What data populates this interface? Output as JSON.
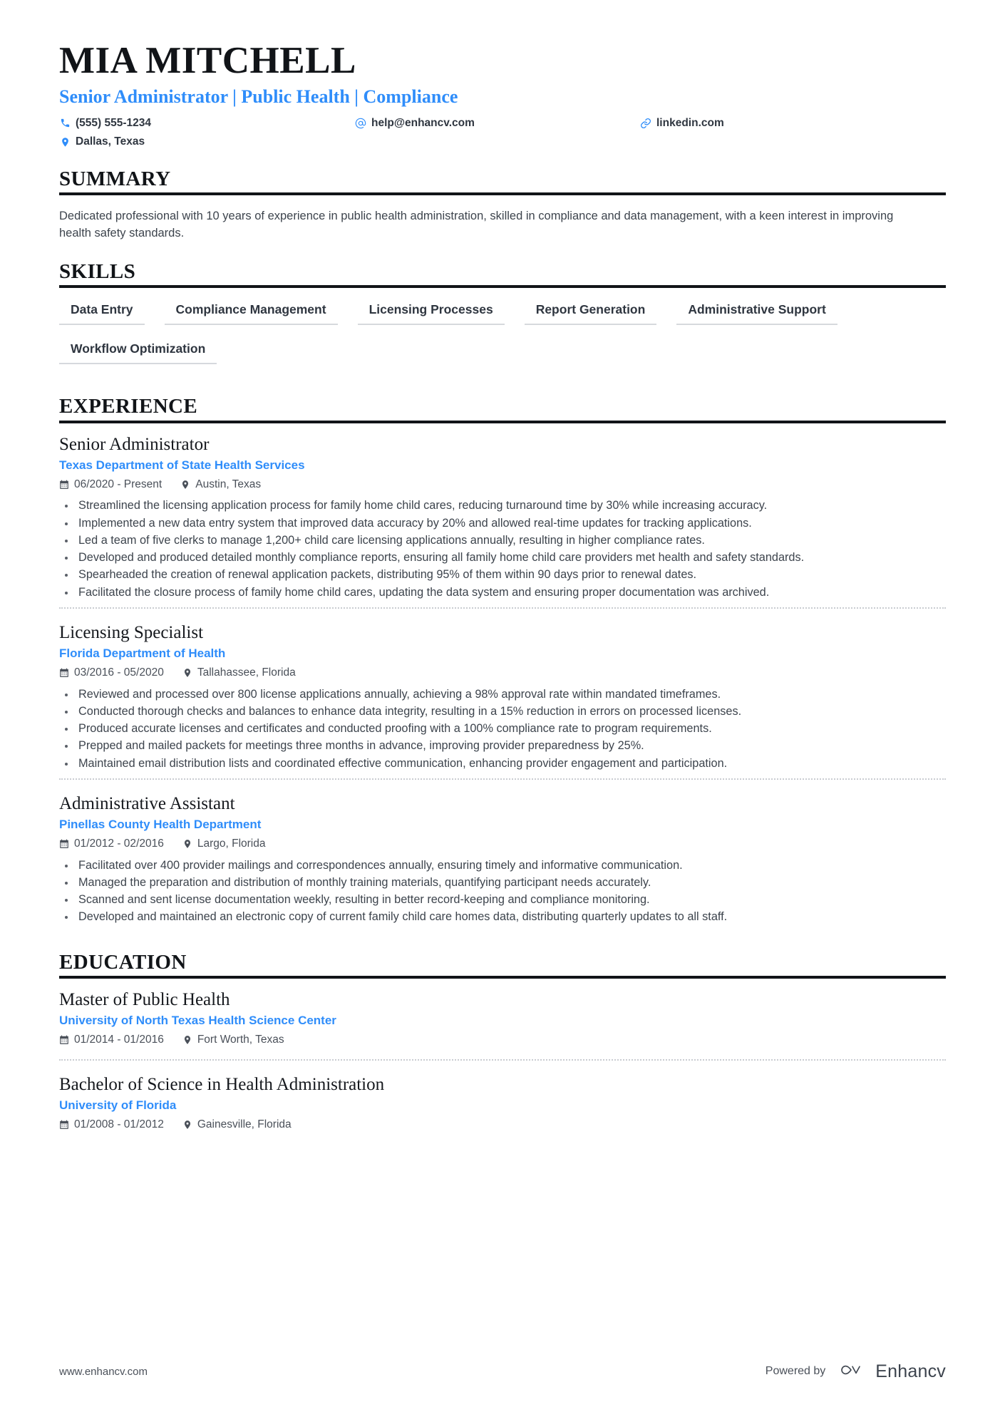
{
  "header": {
    "name": "MIA MITCHELL",
    "title": "Senior Administrator | Public Health | Compliance",
    "contacts": {
      "phone": "(555) 555-1234",
      "email": "help@enhancv.com",
      "link": "linkedin.com",
      "location": "Dallas, Texas"
    },
    "icons": {
      "phone": "phone-icon",
      "email": "at-sign-icon",
      "link": "link-icon",
      "location": "map-pin-icon"
    }
  },
  "colors": {
    "accent_blue": "#2f8dfa",
    "heading_black": "#111418",
    "body_gray": "#3d444d",
    "rule_gray": "#d6d9dd"
  },
  "sections": {
    "summary": {
      "title": "SUMMARY",
      "text": "Dedicated professional with 10 years of experience in public health administration, skilled in compliance and data management, with a keen interest in improving health safety standards."
    },
    "skills": {
      "title": "SKILLS",
      "items": [
        "Data Entry",
        "Compliance Management",
        "Licensing Processes",
        "Report Generation",
        "Administrative Support",
        "Workflow Optimization"
      ]
    },
    "experience": {
      "title": "EXPERIENCE",
      "entries": [
        {
          "role": "Senior Administrator",
          "organization": "Texas Department of State Health Services",
          "dates": "06/2020 - Present",
          "location": "Austin, Texas",
          "bullets": [
            "Streamlined the licensing application process for family home child cares, reducing turnaround time by 30% while increasing accuracy.",
            "Implemented a new data entry system that improved data accuracy by 20% and allowed real-time updates for tracking applications.",
            "Led a team of five clerks to manage 1,200+ child care licensing applications annually, resulting in higher compliance rates.",
            "Developed and produced detailed monthly compliance reports, ensuring all family home child care providers met health and safety standards.",
            "Spearheaded the creation of renewal application packets, distributing 95% of them within 90 days prior to renewal dates.",
            "Facilitated the closure process of family home child cares, updating the data system and ensuring proper documentation was archived."
          ]
        },
        {
          "role": "Licensing Specialist",
          "organization": "Florida Department of Health",
          "dates": "03/2016 - 05/2020",
          "location": "Tallahassee, Florida",
          "bullets": [
            "Reviewed and processed over 800 license applications annually, achieving a 98% approval rate within mandated timeframes.",
            "Conducted thorough checks and balances to enhance data integrity, resulting in a 15% reduction in errors on processed licenses.",
            "Produced accurate licenses and certificates and conducted proofing with a 100% compliance rate to program requirements.",
            "Prepped and mailed packets for meetings three months in advance, improving provider preparedness by 25%.",
            "Maintained email distribution lists and coordinated effective communication, enhancing provider engagement and participation."
          ]
        },
        {
          "role": "Administrative Assistant",
          "organization": "Pinellas County Health Department",
          "dates": "01/2012 - 02/2016",
          "location": "Largo, Florida",
          "bullets": [
            "Facilitated over 400 provider mailings and correspondences annually, ensuring timely and informative communication.",
            "Managed the preparation and distribution of monthly training materials, quantifying participant needs accurately.",
            "Scanned and sent license documentation weekly, resulting in better record-keeping and compliance monitoring.",
            "Developed and maintained an electronic copy of current family child care homes data, distributing quarterly updates to all staff."
          ]
        }
      ]
    },
    "education": {
      "title": "EDUCATION",
      "entries": [
        {
          "role": "Master of Public Health",
          "organization": "University of North Texas Health Science Center",
          "dates": "01/2014 - 01/2016",
          "location": "Fort Worth, Texas",
          "bullets": []
        },
        {
          "role": "Bachelor of Science in Health Administration",
          "organization": "University of Florida",
          "dates": "01/2008 - 01/2012",
          "location": "Gainesville, Florida",
          "bullets": []
        }
      ]
    }
  },
  "footer": {
    "website": "www.enhancv.com",
    "powered_by": "Powered by",
    "brand": "Enhancv"
  }
}
